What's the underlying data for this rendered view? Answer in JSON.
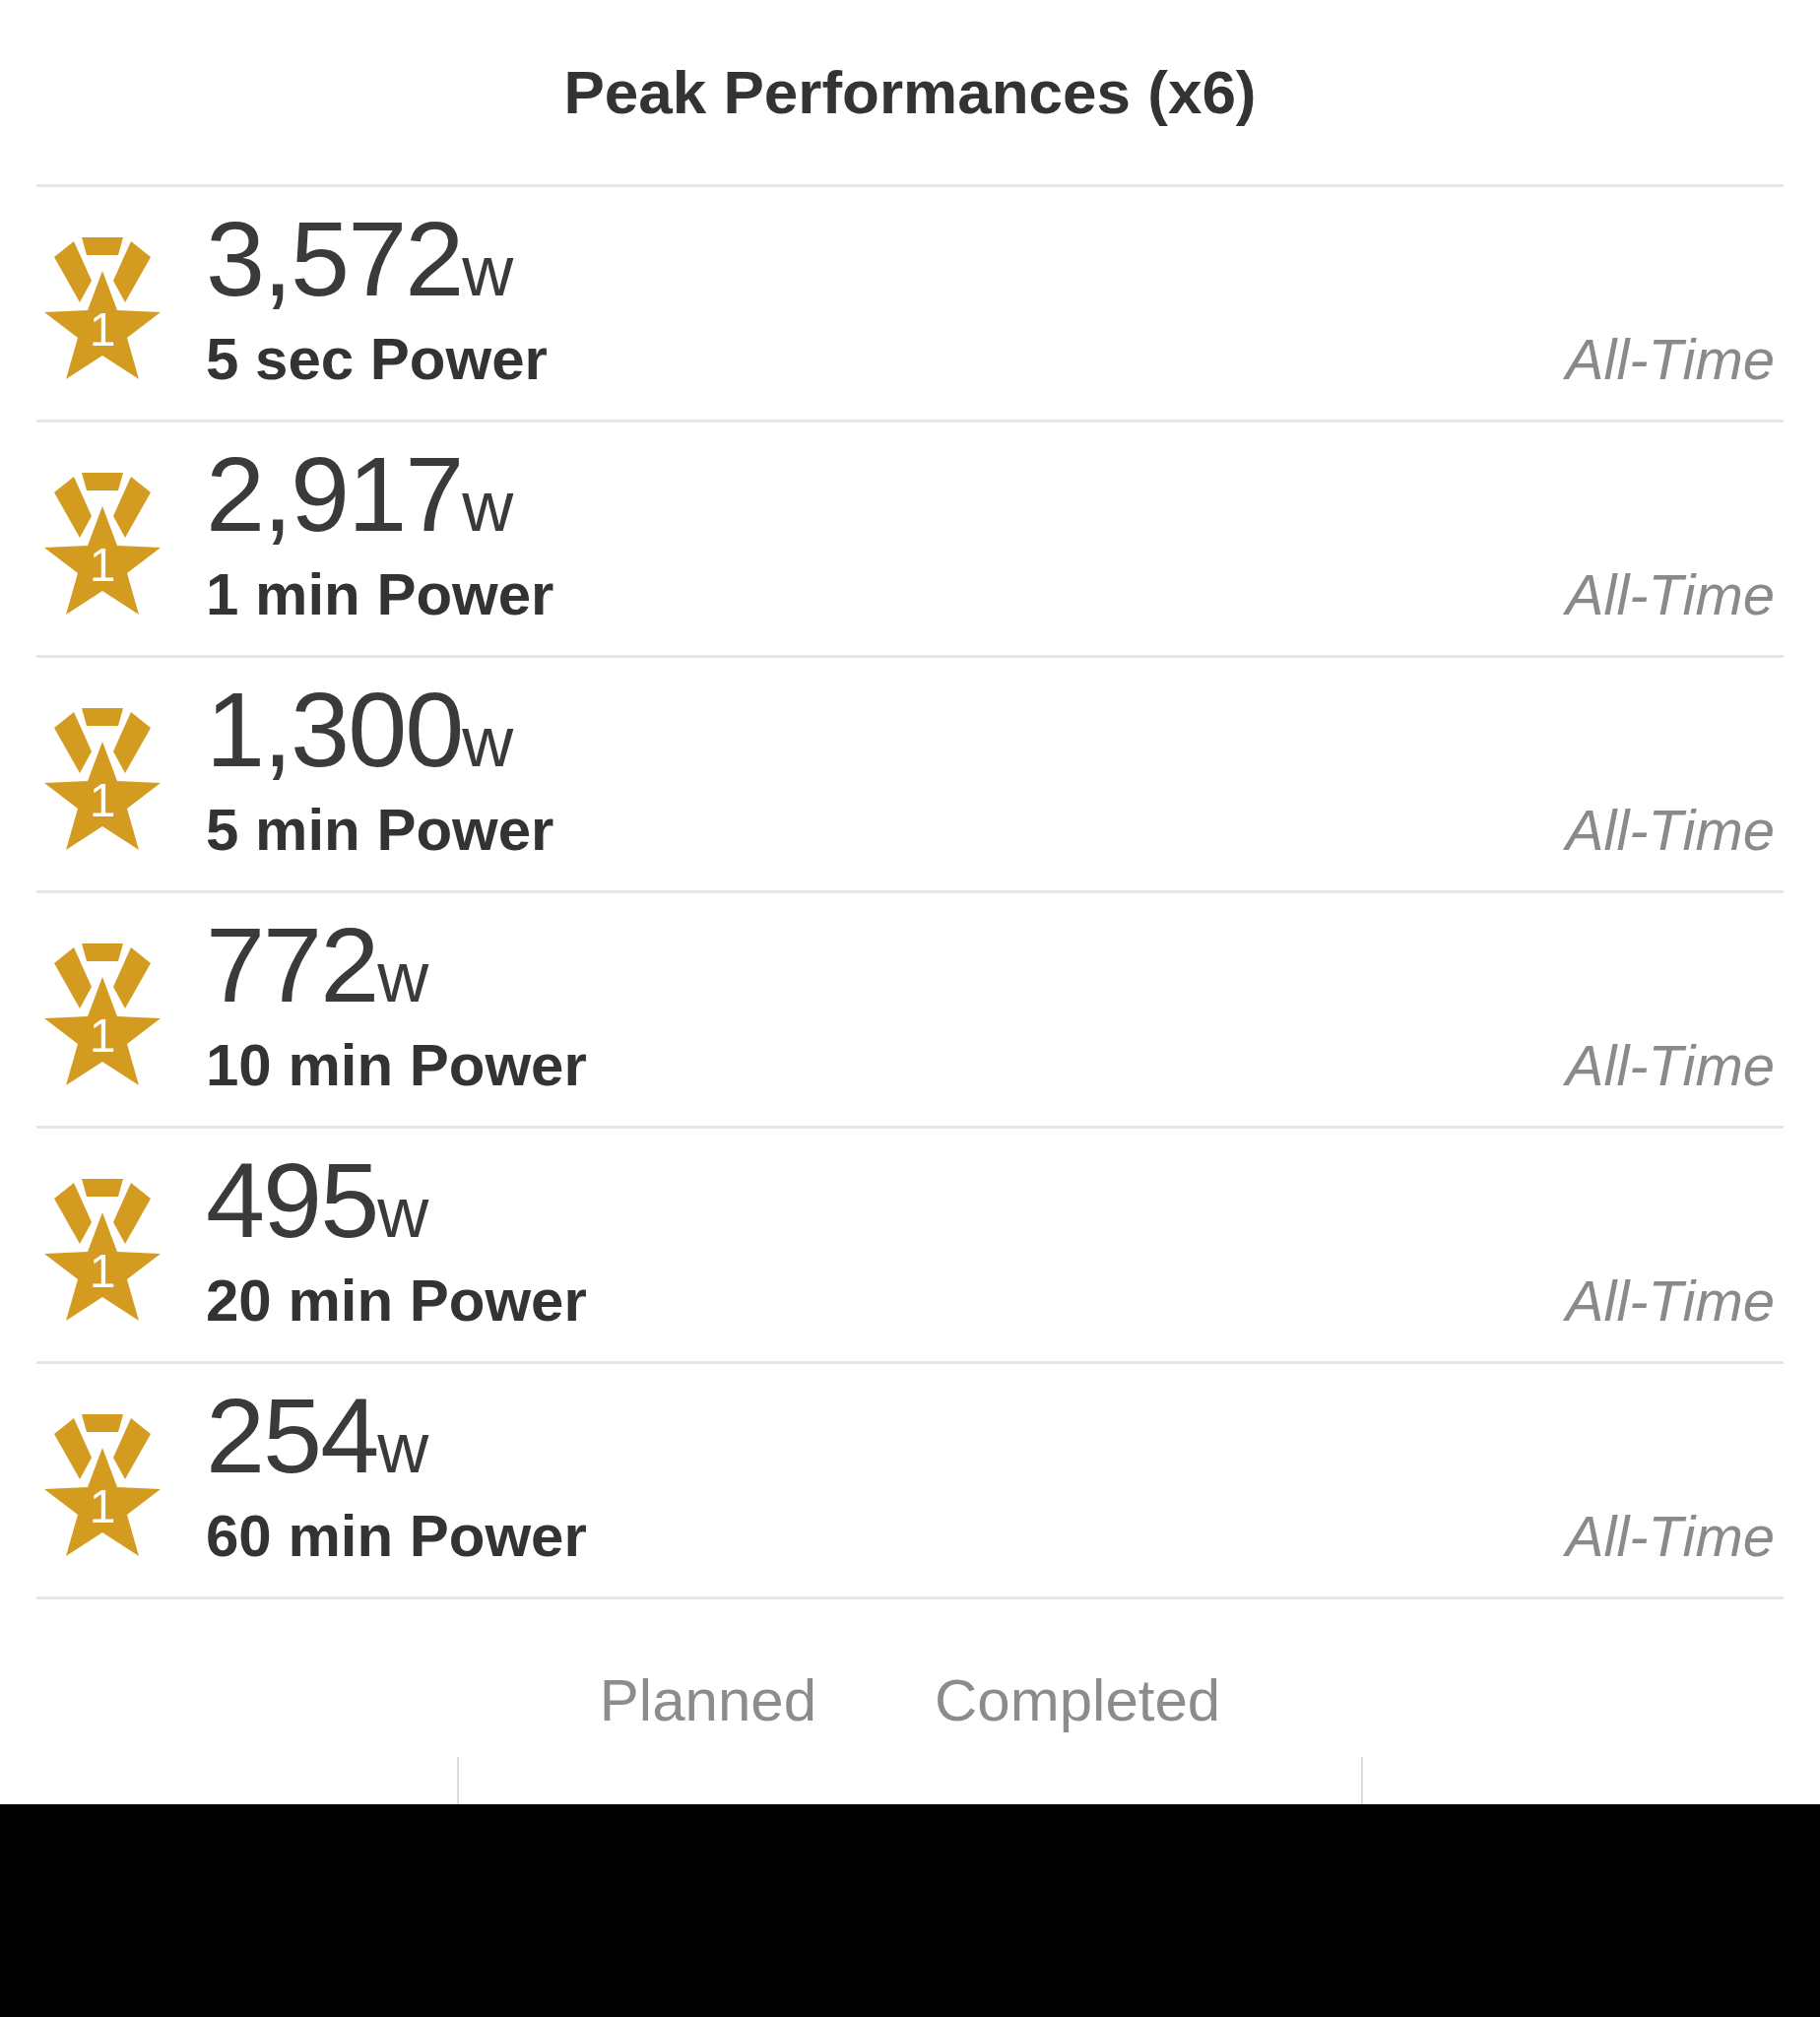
{
  "title": "Peak Performances (x6)",
  "records": [
    {
      "rank": "1",
      "value": "3,572",
      "unit": "w",
      "label": "5 sec Power",
      "period": "All-Time"
    },
    {
      "rank": "1",
      "value": "2,917",
      "unit": "w",
      "label": "1 min Power",
      "period": "All-Time"
    },
    {
      "rank": "1",
      "value": "1,300",
      "unit": "w",
      "label": "5 min Power",
      "period": "All-Time"
    },
    {
      "rank": "1",
      "value": "772",
      "unit": "w",
      "label": "10 min Power",
      "period": "All-Time"
    },
    {
      "rank": "1",
      "value": "495",
      "unit": "w",
      "label": "20 min Power",
      "period": "All-Time"
    },
    {
      "rank": "1",
      "value": "254",
      "unit": "w",
      "label": "60 min Power",
      "period": "All-Time"
    }
  ],
  "tabs": [
    {
      "label": "Planned",
      "selected": false
    },
    {
      "label": "Completed",
      "selected": false
    }
  ]
}
